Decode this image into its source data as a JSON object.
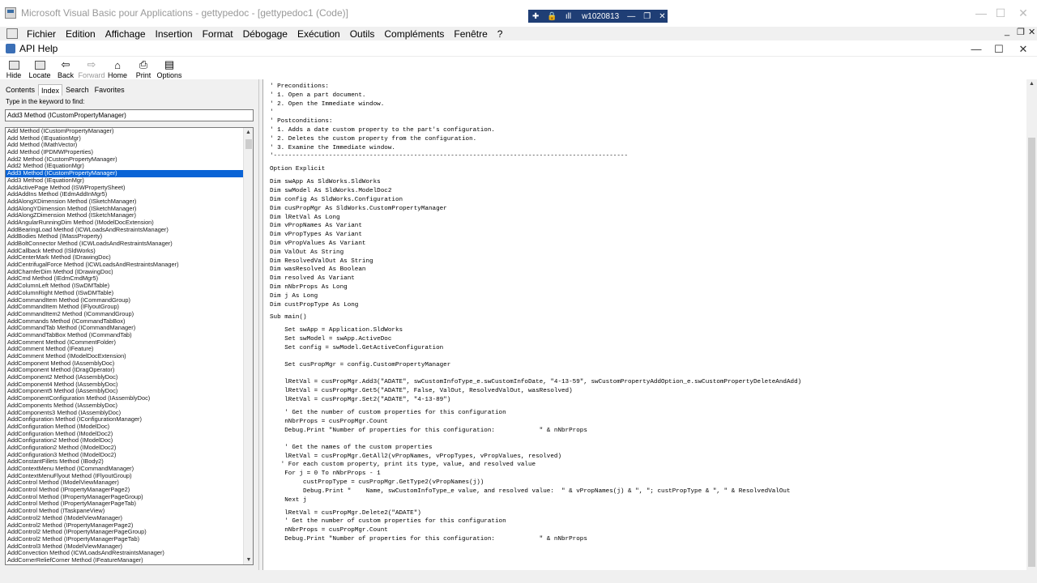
{
  "vba_window": {
    "title": "Microsoft Visual Basic pour Applications - gettypedoc - [gettypedoc1 (Code)]",
    "controls": {
      "minimize": "—",
      "maximize": "☐",
      "close": "✕"
    },
    "mdi_controls": {
      "minimize": "_",
      "restore": "❐",
      "close": "✕"
    }
  },
  "remote_session": {
    "pin": "✚",
    "lock": "🔒",
    "signal": "ıll",
    "name": "w1020813",
    "minimize": "—",
    "restore": "❐",
    "close": "✕"
  },
  "menu": {
    "items": [
      "Fichier",
      "Edition",
      "Affichage",
      "Insertion",
      "Format",
      "Débogage",
      "Exécution",
      "Outils",
      "Compléments",
      "Fenêtre",
      "?"
    ]
  },
  "help_window": {
    "title": "API Help",
    "controls": {
      "minimize": "—",
      "maximize": "☐",
      "close": "✕"
    }
  },
  "toolbar": {
    "buttons": [
      {
        "label": "Hide",
        "icon": "hide-icon",
        "glyph": "▯",
        "enabled": true
      },
      {
        "label": "Locate",
        "icon": "locate-icon",
        "glyph": "▯",
        "enabled": true
      },
      {
        "label": "Back",
        "icon": "back-arrow-icon",
        "glyph": "⇦",
        "enabled": true
      },
      {
        "label": "Forward",
        "icon": "forward-arrow-icon",
        "glyph": "⇨",
        "enabled": false
      },
      {
        "label": "Home",
        "icon": "home-icon",
        "glyph": "⌂",
        "enabled": true
      },
      {
        "label": "Print",
        "icon": "printer-icon",
        "glyph": "⎙",
        "enabled": true
      },
      {
        "label": "Options",
        "icon": "options-icon",
        "glyph": "▤",
        "enabled": true
      }
    ]
  },
  "nav": {
    "tabs": [
      "Contents",
      "Index",
      "Search",
      "Favorites"
    ],
    "active_tab": "Index",
    "keyword_prompt": "Type in the keyword to find:",
    "keyword_value": "Add3 Method (ICustomPropertyManager)",
    "scroll_up": "▲",
    "scroll_down": "▼",
    "selected_index": 6,
    "index_items": [
      "Add Method (ICustomPropertyManager)",
      "Add Method (IEquationMgr)",
      "Add Method (IMathVector)",
      "Add Method (IPDMWProperties)",
      "Add2 Method (ICustomPropertyManager)",
      "Add2 Method (IEquationMgr)",
      "Add3 Method (ICustomPropertyManager)",
      "Add3 Method (IEquationMgr)",
      "AddActivePage Method (ISWPropertySheet)",
      "AddAddIns Method (IEdmAddInMgr5)",
      "AddAlongXDimension Method (ISketchManager)",
      "AddAlongYDimension Method (ISketchManager)",
      "AddAlongZDimension Method (ISketchManager)",
      "AddAngularRunningDim Method (IModelDocExtension)",
      "AddBearingLoad Method (ICWLoadsAndRestraintsManager)",
      "AddBodies Method (IMassProperty)",
      "AddBoltConnector Method (ICWLoadsAndRestraintsManager)",
      "AddCallback Method (ISldWorks)",
      "AddCenterMark Method (IDrawingDoc)",
      "AddCentrifugalForce Method (ICWLoadsAndRestraintsManager)",
      "AddChamferDim Method (IDrawingDoc)",
      "AddCmd Method (IEdmCmdMgr5)",
      "AddColumnLeft Method (ISwDMTable)",
      "AddColumnRight Method (ISwDMTable)",
      "AddCommandItem Method (ICommandGroup)",
      "AddCommandItem Method (IFlyoutGroup)",
      "AddCommandItem2 Method (ICommandGroup)",
      "AddCommands Method (ICommandTabBox)",
      "AddCommandTab Method (ICommandManager)",
      "AddCommandTabBox Method (ICommandTab)",
      "AddComment Method (ICommentFolder)",
      "AddComment Method (IFeature)",
      "AddComment Method (IModelDocExtension)",
      "AddComponent Method (IAssemblyDoc)",
      "AddComponent Method (IDragOperator)",
      "AddComponent2 Method (IAssemblyDoc)",
      "AddComponent4 Method (IAssemblyDoc)",
      "AddComponent5 Method (IAssemblyDoc)",
      "AddComponentConfiguration Method (IAssemblyDoc)",
      "AddComponents Method (IAssemblyDoc)",
      "AddComponents3 Method (IAssemblyDoc)",
      "AddConfiguration Method (IConfigurationManager)",
      "AddConfiguration Method (IModelDoc)",
      "AddConfiguration Method (IModelDoc2)",
      "AddConfiguration2 Method (IModelDoc)",
      "AddConfiguration2 Method (IModelDoc2)",
      "AddConfiguration3 Method (IModelDoc2)",
      "AddConstantFillets Method (IBody2)",
      "AddContextMenu Method (ICommandManager)",
      "AddContextMenuFlyout Method (IFlyoutGroup)",
      "AddControl Method (IModelViewManager)",
      "AddControl Method (IPropertyManagerPage2)",
      "AddControl Method (IPropertyManagerPageGroup)",
      "AddControl Method (IPropertyManagerPageTab)",
      "AddControl Method (ITaskpaneView)",
      "AddControl2 Method (IModelViewManager)",
      "AddControl2 Method (IPropertyManagerPage2)",
      "AddControl2 Method (IPropertyManagerPageGroup)",
      "AddControl2 Method (IPropertyManagerPageTab)",
      "AddControl3 Method (IModelViewManager)",
      "AddConvection Method (ICWLoadsAndRestraintsManager)",
      "AddCornerReliefCorner Method (IFeatureManager)"
    ]
  },
  "code": {
    "lines": [
      "' Preconditions:",
      "' 1. Open a part document.",
      "' 2. Open the Immediate window.",
      "'",
      "' Postconditions:",
      "' 1. Adds a date custom property to the part's configuration.",
      "' 2. Deletes the custom property from the configuration.",
      "' 3. Examine the Immediate window.",
      "'------------------------------------------------------------------------------------------------",
      "",
      "Option Explicit",
      "",
      "Dim swApp As SldWorks.SldWorks",
      "Dim swModel As SldWorks.ModelDoc2",
      "Dim config As SldWorks.Configuration",
      "Dim cusPropMgr As SldWorks.CustomPropertyManager",
      "Dim lRetVal As Long",
      "Dim vPropNames As Variant",
      "Dim vPropTypes As Variant",
      "Dim vPropValues As Variant",
      "Dim ValOut As String",
      "Dim ResolvedValOut As String",
      "Dim wasResolved As Boolean",
      "Dim resolved As Variant",
      "Dim nNbrProps As Long",
      "Dim j As Long",
      "Dim custPropType As Long",
      "",
      "Sub main()",
      "",
      "    Set swApp = Application.SldWorks",
      "    Set swModel = swApp.ActiveDoc",
      "    Set config = swModel.GetActiveConfiguration",
      "",
      "",
      "    Set cusPropMgr = config.CustomPropertyManager",
      "",
      "",
      "    lRetVal = cusPropMgr.Add3(\"ADATE\", swCustomInfoType_e.swCustomInfoDate, \"4-13-59\", swCustomPropertyAddOption_e.swCustomPropertyDeleteAndAdd)",
      "    lRetVal = cusPropMgr.Get5(\"ADATE\", False, ValOut, ResolvedValOut, wasResolved)",
      "    lRetVal = cusPropMgr.Set2(\"ADATE\", \"4-13-89\")",
      "",
      "    ' Get the number of custom properties for this configuration",
      "    nNbrProps = cusPropMgr.Count",
      "    Debug.Print \"Number of properties for this configuration:            \" & nNbrProps",
      "",
      "",
      "    ' Get the names of the custom properties",
      "    lRetVal = cusPropMgr.GetAll2(vPropNames, vPropTypes, vPropValues, resolved)",
      "   ' For each custom property, print its type, value, and resolved value",
      "    For j = 0 To nNbrProps - 1",
      "         custPropType = cusPropMgr.GetType2(vPropNames(j))",
      "         Debug.Print \"    Name, swCustomInfoType_e value, and resolved value:  \" & vPropNames(j) & \", \"; custPropType & \", \" & ResolvedValOut",
      "    Next j",
      "",
      "    lRetVal = cusPropMgr.Delete2(\"ADATE\")",
      "    ' Get the number of custom properties for this configuration",
      "    nNbrProps = cusPropMgr.Count",
      "    Debug.Print \"Number of properties for this configuration:            \" & nNbrProps"
    ]
  }
}
